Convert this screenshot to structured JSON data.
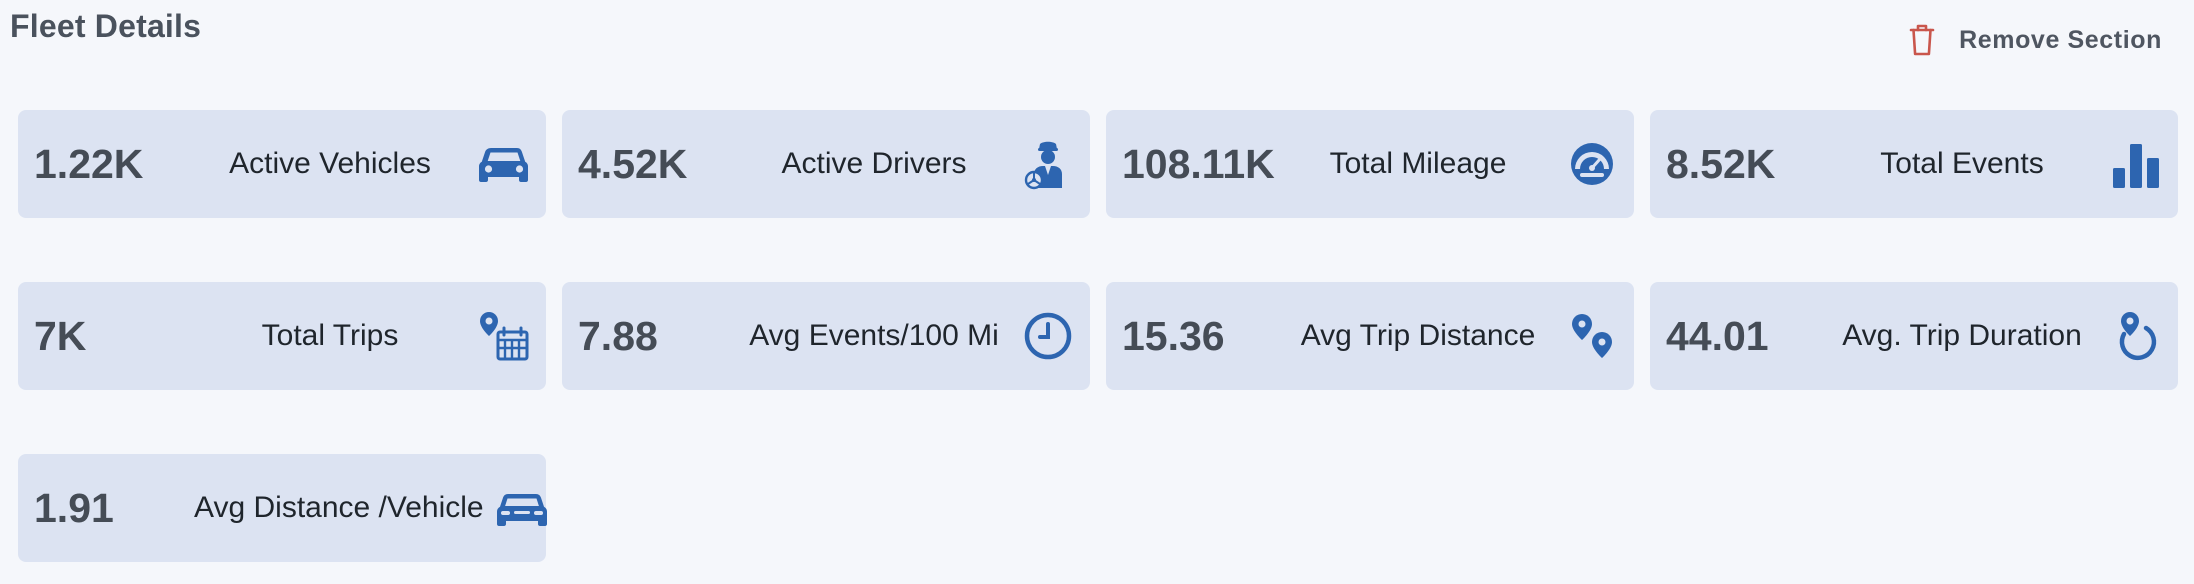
{
  "section": {
    "title": "Fleet Details",
    "remove_label": "Remove Section",
    "remove_icon": "trash-icon"
  },
  "colors": {
    "icon_blue": "#2d65b0",
    "card_bg": "#dce3f2",
    "page_bg": "#f5f7fb",
    "trash_red": "#c9564c"
  },
  "metrics": [
    {
      "value": "1.22K",
      "label": "Active Vehicles",
      "icon": "car-icon"
    },
    {
      "value": "4.52K",
      "label": "Active Drivers",
      "icon": "driver-icon"
    },
    {
      "value": "108.11K",
      "label": "Total Mileage",
      "icon": "speedometer-icon"
    },
    {
      "value": "8.52K",
      "label": "Total Events",
      "icon": "bar-chart-icon"
    },
    {
      "value": "7K",
      "label": "Total Trips",
      "icon": "trip-calendar-icon"
    },
    {
      "value": "7.88",
      "label": "Avg Events/100 Mi",
      "icon": "clock-icon"
    },
    {
      "value": "15.36",
      "label": "Avg Trip Distance",
      "icon": "map-pins-icon"
    },
    {
      "value": "44.01",
      "label": "Avg. Trip Duration",
      "icon": "pin-duration-icon"
    },
    {
      "value": "1.91",
      "label": "Avg Distance /Vehicle",
      "icon": "vehicle-front-icon"
    }
  ]
}
